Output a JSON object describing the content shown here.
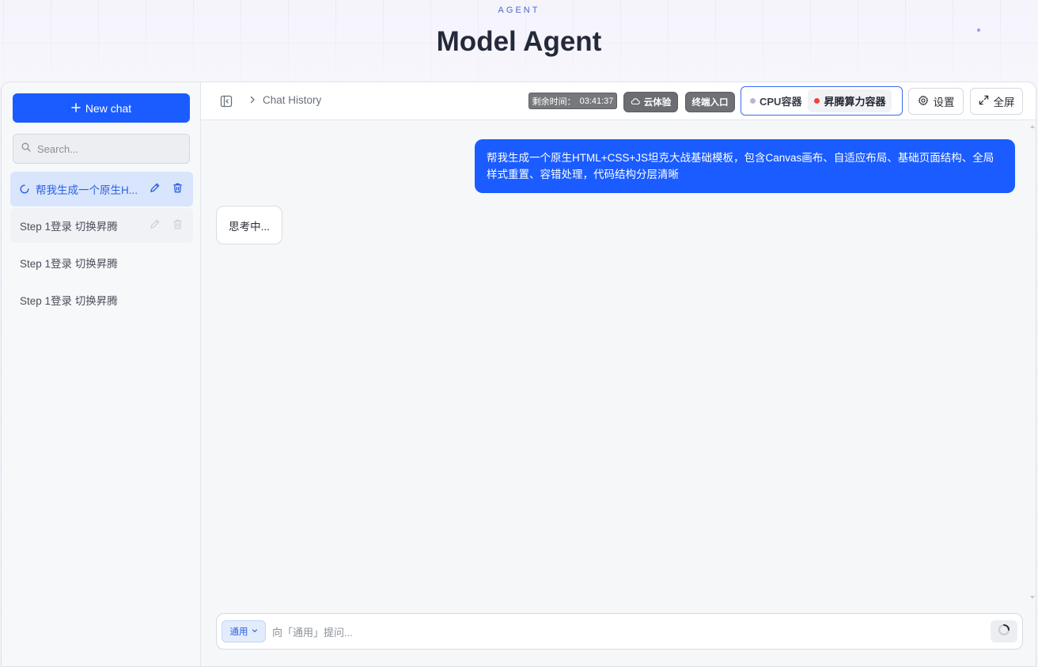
{
  "hero": {
    "kicker": "AGENT",
    "title": "Model Agent"
  },
  "sidebar": {
    "new_chat_label": "New chat",
    "search_placeholder": "Search...",
    "items": [
      {
        "label": "帮我生成一个原生H...",
        "active": true,
        "loading": true
      },
      {
        "label": "Step 1登录 切换昇腾",
        "hover": true
      },
      {
        "label": "Step 1登录 切换昇腾"
      },
      {
        "label": "Step 1登录 切换昇腾"
      }
    ]
  },
  "topbar": {
    "breadcrumb": "Chat History",
    "timer_label": "剩余时间：",
    "timer_value": "03:41:37",
    "cloud_label": "云体验",
    "terminal_label": "终端入口",
    "containers": [
      {
        "label": "CPU容器",
        "dot_color": "#b8b6d8",
        "selected": false
      },
      {
        "label": "昇腾算力容器",
        "dot_color": "#f04438",
        "selected": true
      }
    ],
    "settings_label": "设置",
    "fullscreen_label": "全屏"
  },
  "chat": {
    "user_message": "帮我生成一个原生HTML+CSS+JS坦克大战基础模板，包含Canvas画布、自适应布局、基础页面结构、全局样式重置、容错处理，代码结构分层清晰",
    "bot_status": "思考中..."
  },
  "composer": {
    "mode_label": "通用",
    "placeholder": "向「通用」提问..."
  },
  "colors": {
    "accent": "#1a5cff",
    "active_bg": "#d8e5fd",
    "status_red": "#f04438"
  }
}
